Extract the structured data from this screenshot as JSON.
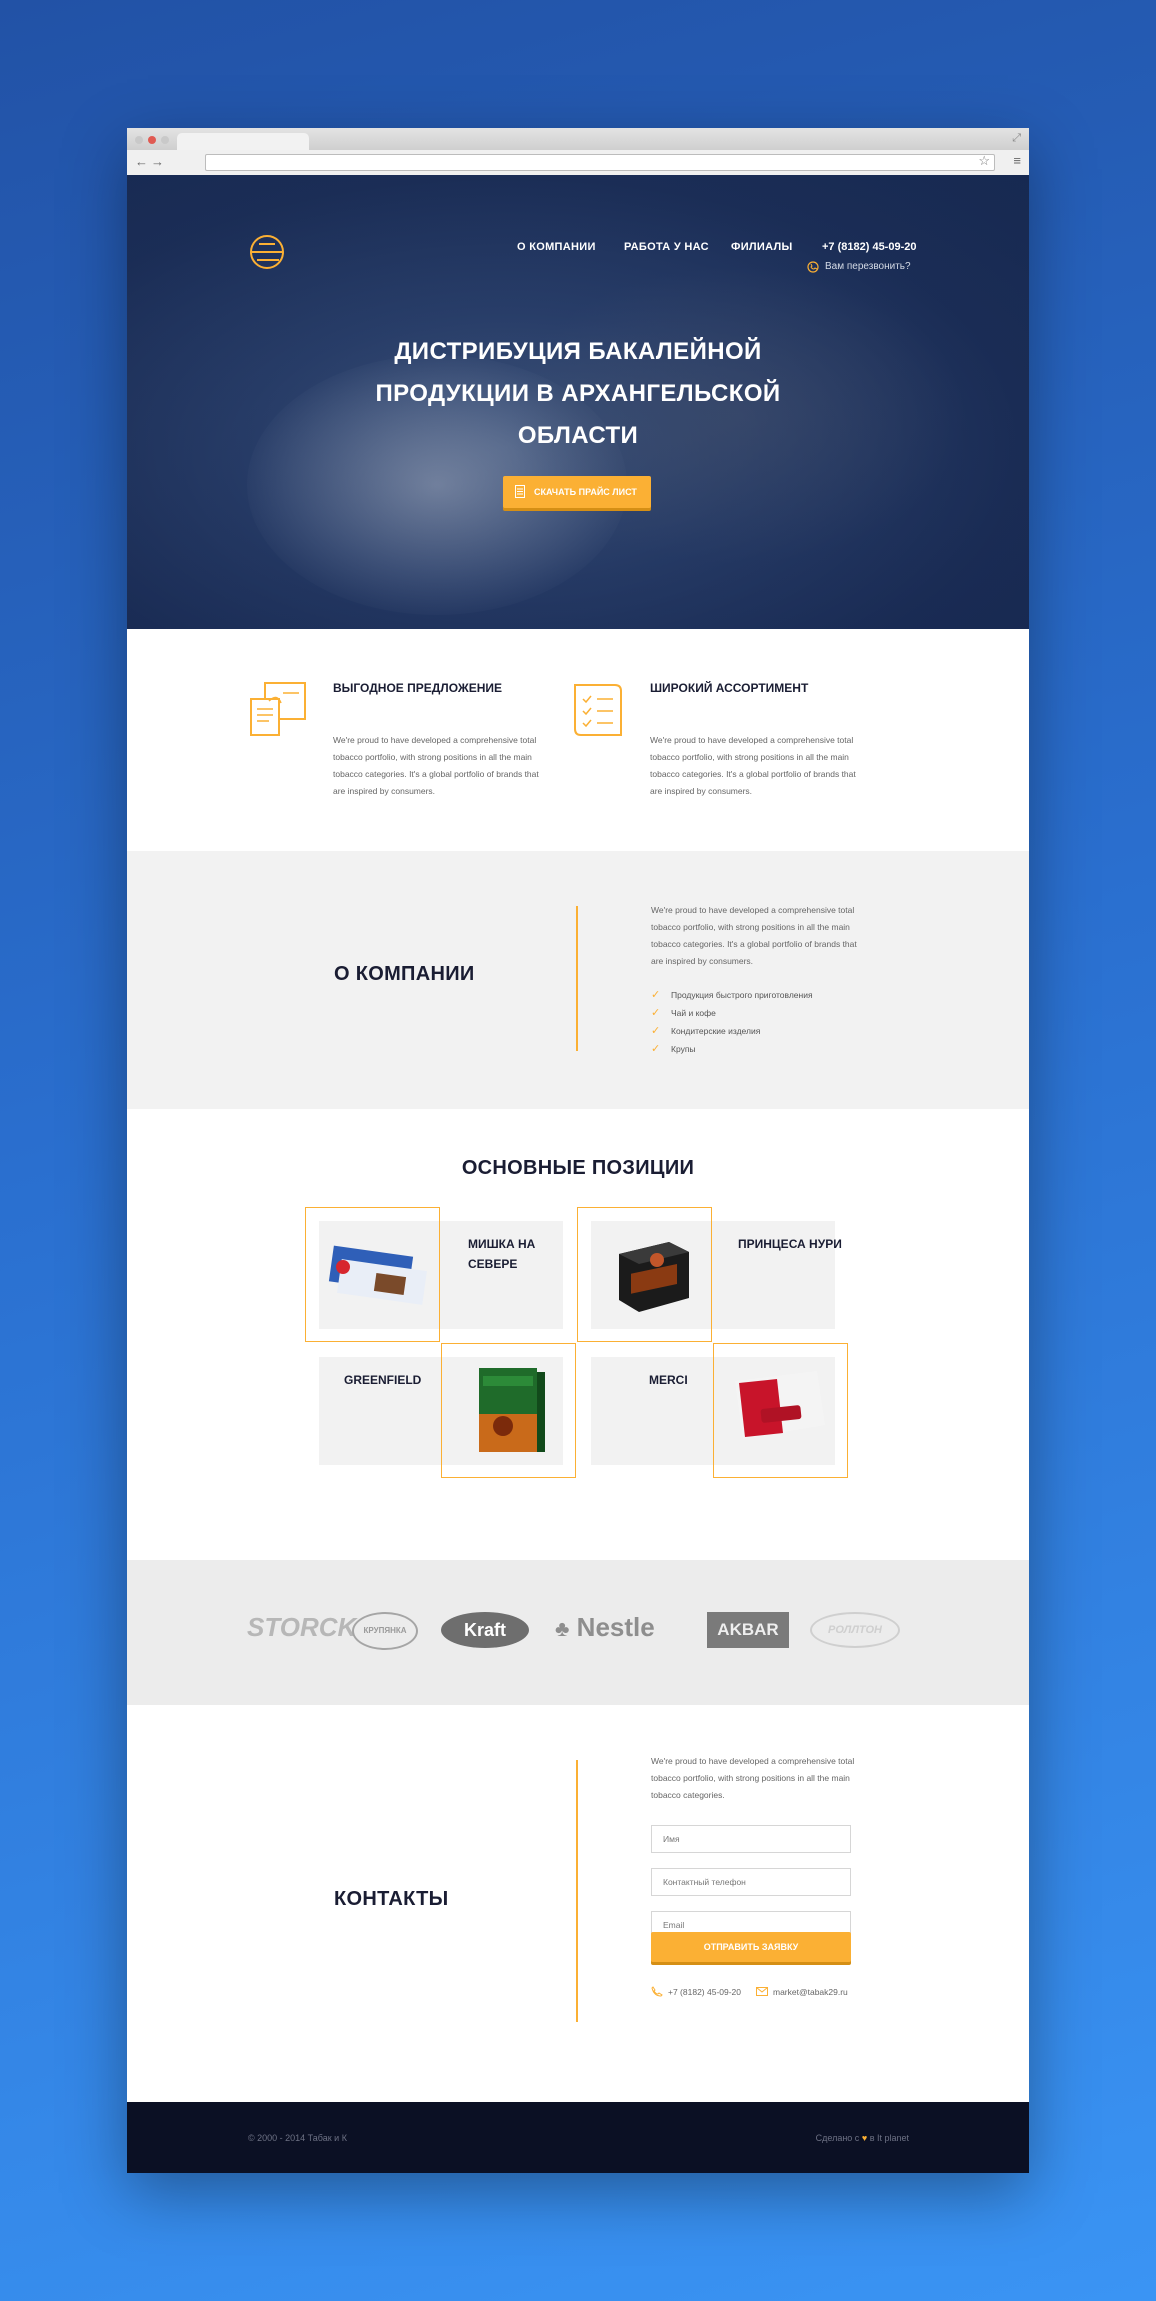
{
  "nav": {
    "about": "О КОМПАНИИ",
    "jobs": "РАБОТА У НАС",
    "branches": "ФИЛИАЛЫ",
    "phone": "+7 (8182) 45-09-20",
    "callback": "Вам перезвонить?"
  },
  "hero": {
    "title": "ДИСТРИБУЦИЯ БАКАЛЕЙНОЙ ПРОДУКЦИИ В АРХАНГЕЛЬСКОЙ ОБЛАСТИ",
    "button": "СКАЧАТЬ ПРАЙС ЛИСТ"
  },
  "features": [
    {
      "title": "ВЫГОДНОЕ ПРЕДЛОЖЕНИЕ",
      "text": "We're proud to have developed a comprehensive total tobacco portfolio, with strong positions in all the main tobacco categories. It's a global portfolio of brands that are inspired by consumers."
    },
    {
      "title": "ШИРОКИЙ АССОРТИМЕНТ",
      "text": "We're proud to have developed a comprehensive total tobacco portfolio, with strong positions in all the main tobacco categories. It's a global portfolio of brands that are inspired by consumers."
    }
  ],
  "about": {
    "title": "О КОМПАНИИ",
    "text": "We're proud to have developed a comprehensive total tobacco portfolio, with strong positions in all the main tobacco categories. It's a global portfolio of brands that are inspired by consumers.",
    "list": [
      "Продукция быстрого приготовления",
      "Чай и кофе",
      "Кондитерские изделия",
      "Крупы"
    ]
  },
  "positions": {
    "heading": "ОСНОВНЫЕ ПОЗИЦИИ",
    "items": [
      {
        "name": "МИШКА НА СЕВЕРЕ"
      },
      {
        "name": "ПРИНЦЕСА НУРИ"
      },
      {
        "name": "GREENFIELD"
      },
      {
        "name": "MERCI"
      }
    ]
  },
  "brands": [
    "STORCK",
    "КРУПЯНКА",
    "Kraft",
    "Nestle",
    "AKBAR",
    "РОЛЛТОН"
  ],
  "contacts": {
    "title": "КОНТАКТЫ",
    "text": "We're proud to have developed a comprehensive total tobacco portfolio, with strong positions in all the main tobacco categories.",
    "name_placeholder": "Имя",
    "phone_placeholder": "Контактный телефон",
    "email_placeholder": "Email",
    "submit": "ОТПРАВИТЬ ЗАЯВКУ",
    "phone": "+7 (8182) 45-09-20",
    "email": "market@tabak29.ru"
  },
  "footer": {
    "copyright": "© 2000 - 2014 Табак и К",
    "made_prefix": "Сделано с",
    "made_suffix": "в It planet"
  },
  "colors": {
    "accent": "#fbb034",
    "dark": "#1a1d33",
    "footer": "#0b1024",
    "gray_section": "#f2f2f2"
  }
}
